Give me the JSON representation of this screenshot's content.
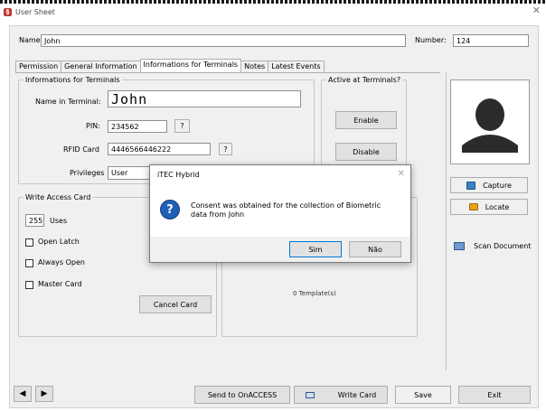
{
  "window": {
    "title": "User Sheet"
  },
  "header": {
    "name_label": "Name:",
    "name_value": "John",
    "number_label": "Number:",
    "number_value": "124"
  },
  "tabs": [
    {
      "label": "Permission",
      "active": false
    },
    {
      "label": "General Information",
      "active": false
    },
    {
      "label": "Informations for Terminals",
      "active": true
    },
    {
      "label": "Notes",
      "active": false
    },
    {
      "label": "Latest Events",
      "active": false
    }
  ],
  "terminals_group": {
    "title": "Informations for Terminals",
    "name_label": "Name in Terminal:",
    "name_value": "John",
    "pin_label": "PIN:",
    "pin_value": "234562",
    "pin_help": "?",
    "rfid_label": "RFID Card",
    "rfid_value": "4446566446222",
    "rfid_help": "?",
    "privileges_label": "Privileges",
    "privileges_value": "User"
  },
  "active_group": {
    "title": "Active at Terminals?",
    "enable_label": "Enable",
    "disable_label": "Disable"
  },
  "write_group": {
    "title": "Write Access Card",
    "uses_value": "255",
    "uses_label": "Uses",
    "open_latch": "Open Latch",
    "always_open": "Always Open",
    "master_card": "Master Card",
    "cancel_card": "Cancel Card"
  },
  "templates_text": "0 Template(s)",
  "photo_panel": {
    "capture_label": "Capture",
    "locate_label": "Locate",
    "scan_label": "Scan Document"
  },
  "dialog": {
    "title": "iTEC Hybrid",
    "message": "Consent was obtained for the collection of Biometric data from John",
    "yes_label": "Sim",
    "no_label": "Não"
  },
  "footer": {
    "send_label": "Send to OnACCESS",
    "write_card_label": "Write Card",
    "save_label": "Save",
    "exit_label": "Exit"
  },
  "colors": {
    "accent": "#0078d7",
    "dialog_icon": "#1f5fb4",
    "avatar": "#2b2b2b"
  }
}
